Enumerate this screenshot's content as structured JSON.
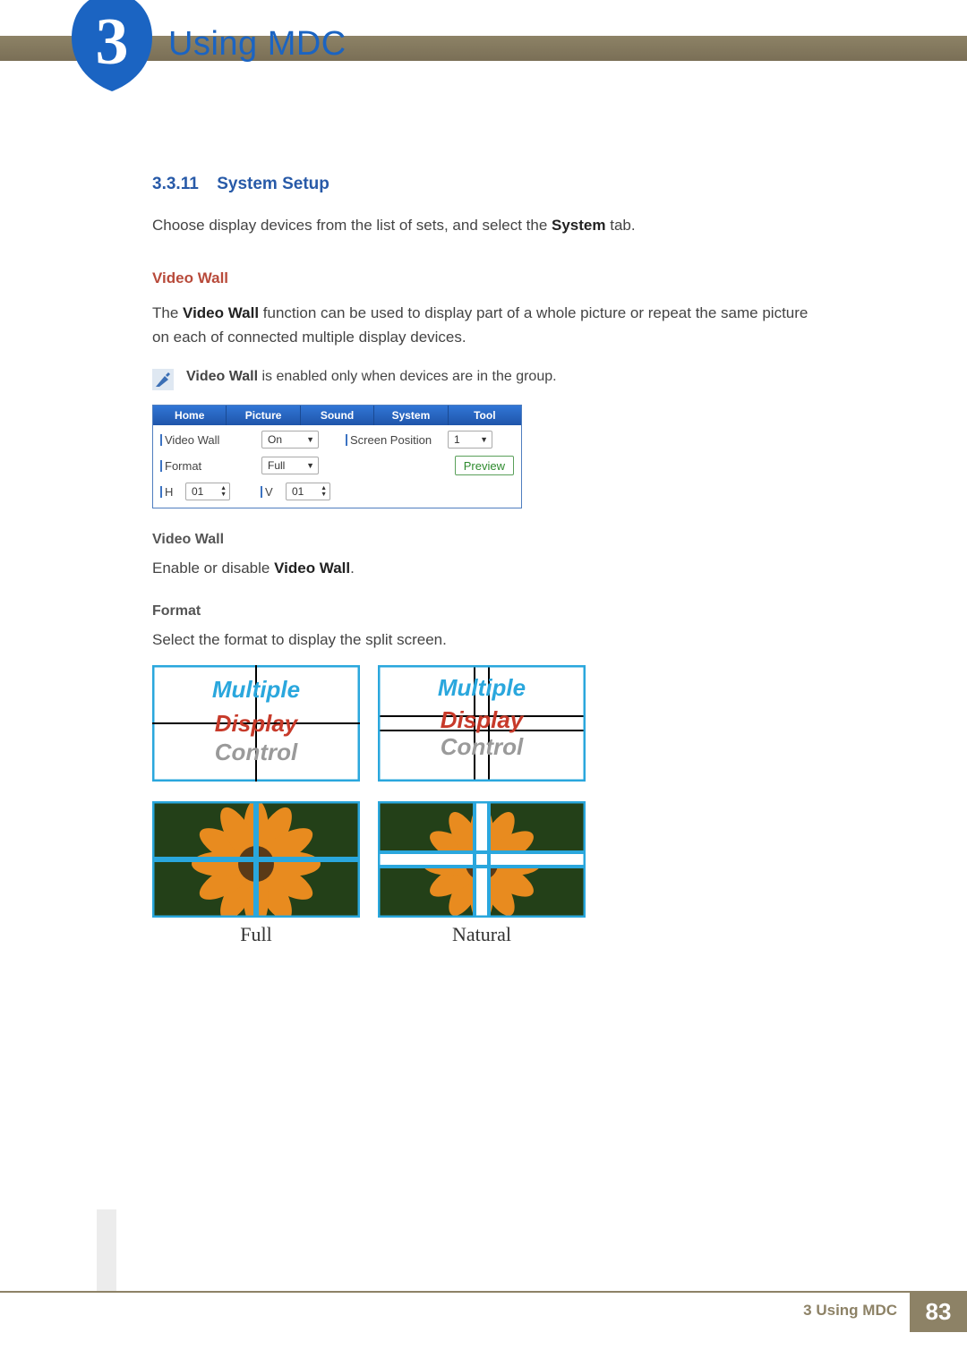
{
  "header": {
    "chapter_number": "3",
    "title": "Using MDC"
  },
  "section": {
    "number": "3.3.11",
    "title": "System Setup",
    "intro_pre": "Choose display devices from the list of sets, and select the ",
    "intro_bold": "System",
    "intro_post": " tab."
  },
  "video_wall": {
    "heading": "Video Wall",
    "desc_pre": "The ",
    "desc_bold": "Video Wall",
    "desc_post": " function can be used to display part of a whole picture or repeat the same picture on each of connected multiple display devices.",
    "note_bold": "Video Wall",
    "note_rest": " is enabled only when devices are in the group."
  },
  "ui": {
    "tabs": [
      "Home",
      "Picture",
      "Sound",
      "System",
      "Tool"
    ],
    "video_wall_label": "Video Wall",
    "video_wall_value": "On",
    "screen_position_label": "Screen Position",
    "screen_position_value": "1",
    "format_label": "Format",
    "format_value": "Full",
    "preview_label": "Preview",
    "h_label": "H",
    "h_value": "01",
    "v_label": "V",
    "v_value": "01"
  },
  "subs": {
    "video_wall_sub": "Video Wall",
    "video_wall_desc_pre": "Enable or disable ",
    "video_wall_desc_bold": "Video Wall",
    "video_wall_desc_post": ".",
    "format_sub": "Format",
    "format_desc": "Select the format to display the split screen."
  },
  "example_text": {
    "line1": "Multiple",
    "line2": "Display",
    "line3": "Control"
  },
  "format_labels": {
    "full": "Full",
    "natural": "Natural"
  },
  "footer": {
    "text": "3 Using MDC",
    "page": "83"
  }
}
